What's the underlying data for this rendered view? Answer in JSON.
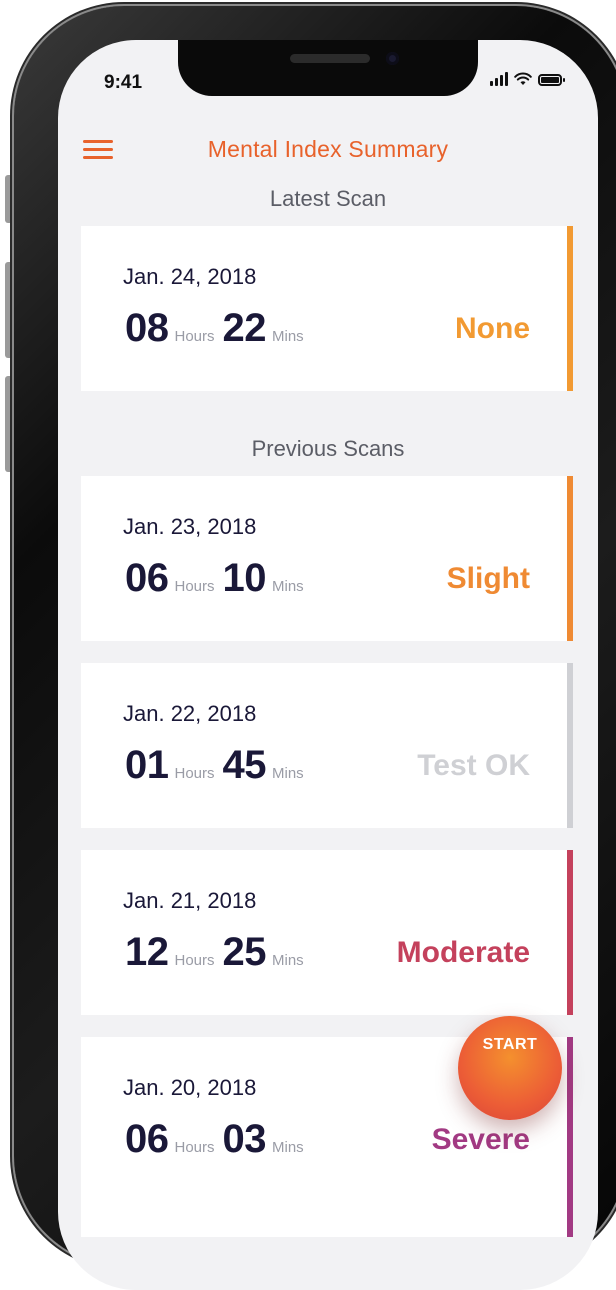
{
  "status_bar": {
    "time": "9:41"
  },
  "header": {
    "title": "Mental Index Summary"
  },
  "sections": {
    "latest": "Latest Scan",
    "previous": "Previous Scans"
  },
  "units": {
    "hours": "Hours",
    "mins": "Mins"
  },
  "latest_scan": {
    "date": "Jan. 24, 2018",
    "hours": "08",
    "mins": "22",
    "status": "None",
    "color": "#f29a32"
  },
  "previous_scans": [
    {
      "date": "Jan. 23, 2018",
      "hours": "06",
      "mins": "10",
      "status": "Slight",
      "color": "#ef8a33"
    },
    {
      "date": "Jan. 22, 2018",
      "hours": "01",
      "mins": "45",
      "status": "Test OK",
      "color": "#cfd0d4"
    },
    {
      "date": "Jan. 21, 2018",
      "hours": "12",
      "mins": "25",
      "status": "Moderate",
      "color": "#c4415c"
    },
    {
      "date": "Jan. 20, 2018",
      "hours": "06",
      "mins": "03",
      "status": "Severe",
      "color": "#a23a83"
    }
  ],
  "start_button": {
    "label": "START"
  },
  "colors": {
    "accent": "#e8622b",
    "text_dark": "#1a1838"
  }
}
